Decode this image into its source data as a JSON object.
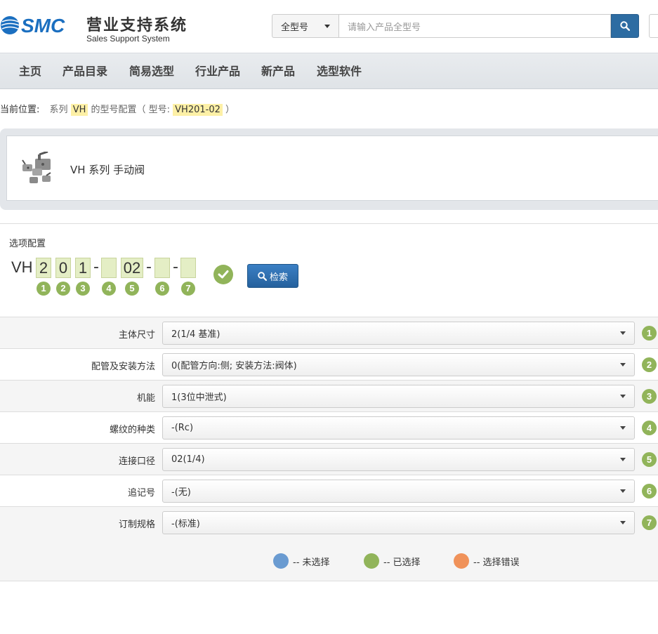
{
  "header": {
    "logo_cn": "营业支持系统",
    "logo_en": "Sales Support System",
    "search_select": "全型号",
    "search_placeholder": "请输入产品全型号",
    "brand_color": "#1b6fc0"
  },
  "nav": [
    "主页",
    "产品目录",
    "简易选型",
    "行业产品",
    "新产品",
    "选型软件"
  ],
  "breadcrumb": {
    "label": "当前位置:",
    "prefix": "系列",
    "series": "VH",
    "middle": "的型号配置（ 型号:",
    "model": "VH201-02",
    "suffix": "）"
  },
  "series_panel": {
    "title": "VH 系列 手动阀"
  },
  "config": {
    "label": "选项配置",
    "prefix": "VH",
    "codes": [
      "2",
      "0",
      "1",
      "",
      "02",
      "",
      ""
    ],
    "badges": [
      "1",
      "2",
      "3",
      "4",
      "5",
      "6",
      "7"
    ],
    "search_button": "检索"
  },
  "options": [
    {
      "name": "主体尺寸",
      "value": "2(1/4 基准)",
      "badge": "1"
    },
    {
      "name": "配管及安装方法",
      "value": "0(配管方向:侧; 安装方法:阀体)",
      "badge": "2"
    },
    {
      "name": "机能",
      "value": "1(3位中泄式)",
      "badge": "3"
    },
    {
      "name": "螺纹的种类",
      "value": "-(Rc)",
      "badge": "4"
    },
    {
      "name": "连接口径",
      "value": "02(1/4)",
      "badge": "5"
    },
    {
      "name": "追记号",
      "value": "-(无)",
      "badge": "6"
    },
    {
      "name": "订制规格",
      "value": "-(标准)",
      "badge": "7"
    }
  ],
  "legend": [
    {
      "label": "-- 未选择",
      "color": "#6a9bd1"
    },
    {
      "label": "-- 已选择",
      "color": "#91b45a"
    },
    {
      "label": "-- 选择错误",
      "color": "#f0925a"
    }
  ]
}
